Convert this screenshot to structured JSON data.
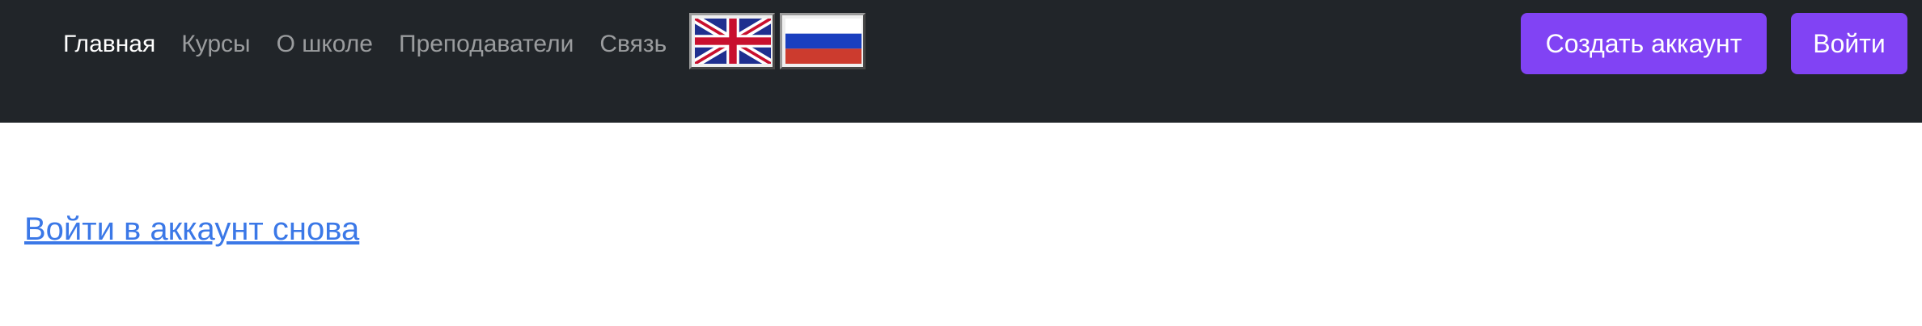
{
  "nav": {
    "links": [
      {
        "label": "Главная",
        "active": true
      },
      {
        "label": "Курсы"
      },
      {
        "label": "О школе"
      },
      {
        "label": "Преподаватели"
      },
      {
        "label": "Связь"
      }
    ],
    "languages": [
      {
        "icon": "uk-flag-icon"
      },
      {
        "icon": "ru-flag-icon"
      }
    ],
    "register_label": "Создать аккаунт",
    "login_label": "Войти"
  },
  "main": {
    "relogin_link": "Войти в аккаунт снова"
  },
  "colors": {
    "navbar_bg": "#212529",
    "accent": "#8143f4",
    "link": "#3b78e7"
  }
}
